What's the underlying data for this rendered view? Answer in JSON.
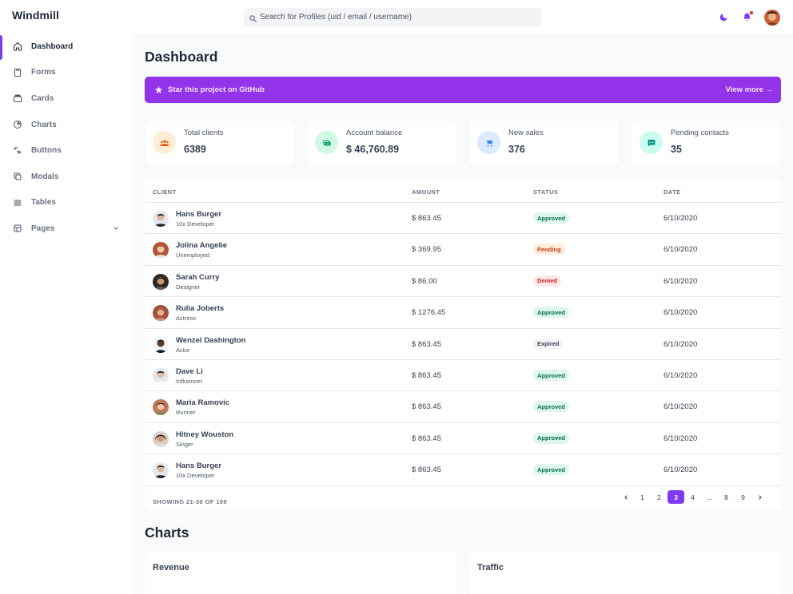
{
  "app": {
    "brand": "Windmill"
  },
  "sidebar": {
    "items": [
      {
        "label": "Dashboard",
        "icon": "home-icon",
        "active": true
      },
      {
        "label": "Forms",
        "icon": "forms-icon"
      },
      {
        "label": "Cards",
        "icon": "cards-icon"
      },
      {
        "label": "Charts",
        "icon": "chart-pie-icon"
      },
      {
        "label": "Buttons",
        "icon": "cursor-click-icon"
      },
      {
        "label": "Modals",
        "icon": "modals-icon"
      },
      {
        "label": "Tables",
        "icon": "table-icon"
      },
      {
        "label": "Pages",
        "icon": "pages-icon"
      }
    ]
  },
  "header": {
    "search_placeholder": "Search for Profiles (uid / email / username)",
    "accent": "#7e3af2"
  },
  "main": {
    "title": "Dashboard",
    "banner": {
      "text": "Star this project on GitHub",
      "link": "View more →",
      "color": "#9333ea"
    },
    "cards": [
      {
        "label": "Total clients",
        "value": "6389",
        "icon": "users-icon",
        "bg": "#ffedd5",
        "fg": "#ea580c"
      },
      {
        "label": "Account balance",
        "value": "$ 46,760.89",
        "icon": "cash-icon",
        "bg": "#d1fae5",
        "fg": "#059669"
      },
      {
        "label": "New sales",
        "value": "376",
        "icon": "cart-icon",
        "bg": "#dbeafe",
        "fg": "#3b82f6"
      },
      {
        "label": "Pending contacts",
        "value": "35",
        "icon": "chat-icon",
        "bg": "#ccfbf1",
        "fg": "#0d9488"
      }
    ],
    "table": {
      "columns": [
        "CLIENT",
        "AMOUNT",
        "STATUS",
        "DATE"
      ],
      "rows": [
        {
          "name": "Hans Burger",
          "job": "10x Developer",
          "amount": "$ 863.45",
          "status": "Approved",
          "date": "6/10/2020"
        },
        {
          "name": "Jolina Angelie",
          "job": "Unemployed",
          "amount": "$ 369.95",
          "status": "Pending",
          "date": "6/10/2020"
        },
        {
          "name": "Sarah Curry",
          "job": "Designer",
          "amount": "$ 86.00",
          "status": "Denied",
          "date": "6/10/2020"
        },
        {
          "name": "Rulia Joberts",
          "job": "Actress",
          "amount": "$ 1276.45",
          "status": "Approved",
          "date": "6/10/2020"
        },
        {
          "name": "Wenzel Dashington",
          "job": "Actor",
          "amount": "$ 863.45",
          "status": "Expired",
          "date": "6/10/2020"
        },
        {
          "name": "Dave Li",
          "job": "Influencer",
          "amount": "$ 863.45",
          "status": "Approved",
          "date": "6/10/2020"
        },
        {
          "name": "Maria Ramovic",
          "job": "Runner",
          "amount": "$ 863.45",
          "status": "Approved",
          "date": "6/10/2020"
        },
        {
          "name": "Hitney Wouston",
          "job": "Singer",
          "amount": "$ 863.45",
          "status": "Approved",
          "date": "6/10/2020"
        },
        {
          "name": "Hans Burger",
          "job": "10x Developer",
          "amount": "$ 863.45",
          "status": "Approved",
          "date": "6/10/2020"
        }
      ],
      "showing": "SHOWING 21-30 OF 100",
      "pages": [
        "1",
        "2",
        "3",
        "4",
        "...",
        "8",
        "9"
      ],
      "current_page": "3"
    },
    "charts_title": "Charts",
    "chart_cards": [
      {
        "title": "Revenue"
      },
      {
        "title": "Traffic"
      }
    ]
  }
}
